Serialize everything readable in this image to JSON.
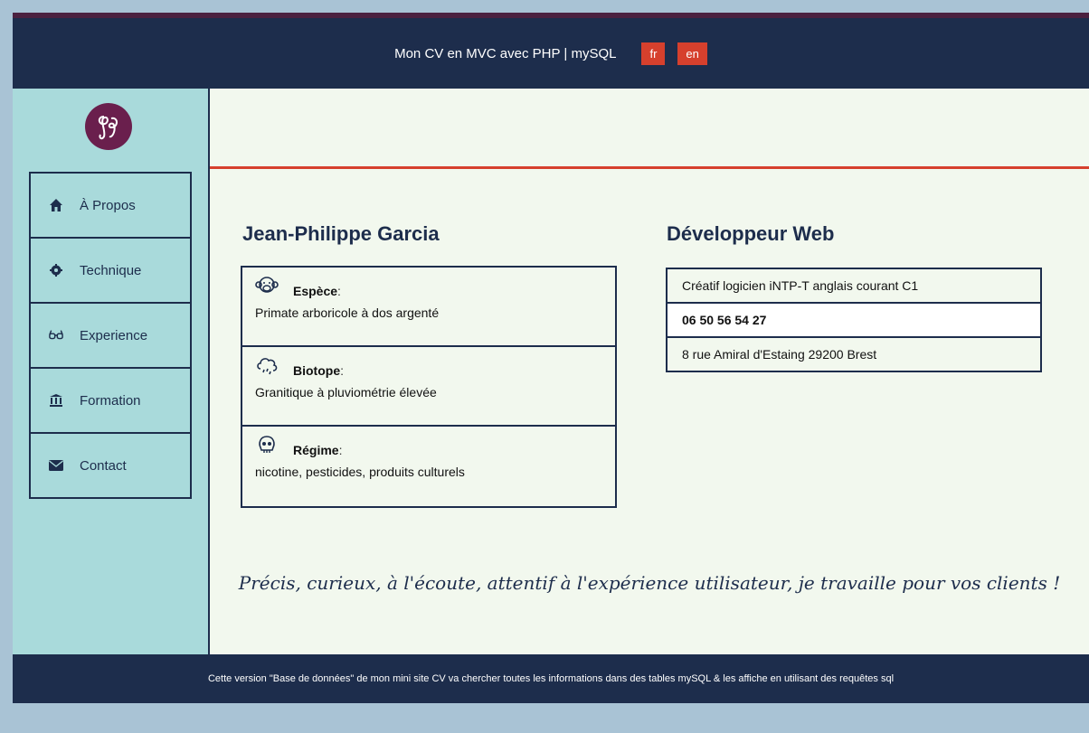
{
  "header": {
    "title": "Mon CV en MVC avec PHP | mySQL",
    "lang_fr": "fr",
    "lang_en": "en"
  },
  "sidebar": {
    "items": [
      {
        "label": "À Propos",
        "icon": "home-icon"
      },
      {
        "label": "Technique",
        "icon": "gear-icon"
      },
      {
        "label": "Experience",
        "icon": "glasses-icon"
      },
      {
        "label": "Formation",
        "icon": "bank-icon"
      },
      {
        "label": "Contact",
        "icon": "envelope-icon"
      }
    ]
  },
  "profile": {
    "name": "Jean-Philippe Garcia",
    "job": "Développeur Web",
    "cards": [
      {
        "label": "Espèce",
        "colon": " :",
        "value": "Primate arboricole à dos argenté",
        "icon": "monkey-icon"
      },
      {
        "label": "Biotope",
        "colon": " :",
        "value": "Granitique à pluviométrie élevée",
        "icon": "rain-cloud-icon"
      },
      {
        "label": "Régime",
        "colon": " :",
        "value": "nicotine, pesticides, produits culturels",
        "icon": "skull-icon"
      }
    ],
    "info": [
      "Créatif logicien iNTP-T anglais courant C1",
      "06 50 56 54 27",
      "8 rue Amiral d'Estaing 29200 Brest"
    ]
  },
  "tagline": "Précis, curieux, à l'écoute, attentif à l'expérience utilisateur, je travaille pour vos clients !",
  "footer": "Cette version \"Base de données\" de mon mini site CV va chercher toutes les informations dans des tables mySQL & les affiche en utilisant des requêtes sql",
  "colors": {
    "navy": "#1d2d4c",
    "accent_red": "#d6402d",
    "sidebar_bg": "#a9dadb",
    "main_bg": "#f2f8ee",
    "logo_bg": "#6a1f4d"
  }
}
